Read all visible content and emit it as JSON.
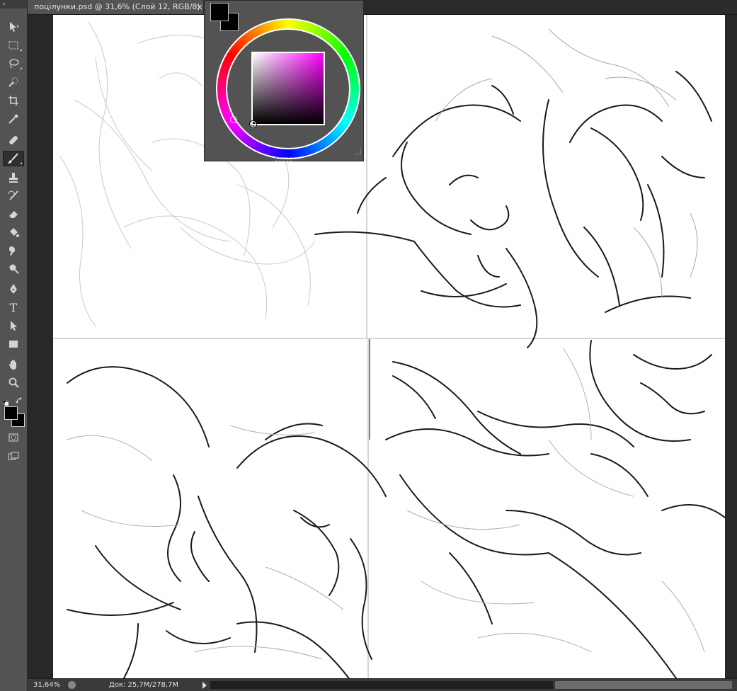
{
  "document_tab": {
    "title": "поцілунки.psd @ 31,6% (Слой 12, RGB/8)",
    "close_glyph": "×"
  },
  "toolbar": {
    "grip": "»",
    "tools": [
      {
        "name": "move",
        "icon": "move-icon"
      },
      {
        "name": "rectangular-marquee",
        "icon": "marquee-icon"
      },
      {
        "name": "lasso",
        "icon": "lasso-icon"
      },
      {
        "name": "quick-selection",
        "icon": "quick-selection-icon"
      },
      {
        "name": "crop",
        "icon": "crop-icon"
      },
      {
        "name": "eyedropper",
        "icon": "eyedropper-icon"
      },
      {
        "name": "spot-healing",
        "icon": "healing-icon"
      },
      {
        "name": "brush",
        "icon": "brush-icon",
        "active": true
      },
      {
        "name": "clone-stamp",
        "icon": "stamp-icon"
      },
      {
        "name": "history-brush",
        "icon": "history-brush-icon"
      },
      {
        "name": "eraser",
        "icon": "eraser-icon"
      },
      {
        "name": "paint-bucket",
        "icon": "bucket-icon"
      },
      {
        "name": "smudge",
        "icon": "smudge-icon"
      },
      {
        "name": "dodge",
        "icon": "dodge-icon"
      },
      {
        "name": "pen",
        "icon": "pen-icon"
      },
      {
        "name": "type",
        "icon": "type-icon",
        "label": "T"
      },
      {
        "name": "path-selection",
        "icon": "path-select-icon"
      },
      {
        "name": "rectangle",
        "icon": "rectangle-icon"
      },
      {
        "name": "hand",
        "icon": "hand-icon"
      },
      {
        "name": "zoom",
        "icon": "zoom-icon"
      }
    ],
    "foreground_color": "#000000",
    "background_color": "#000000"
  },
  "color_panel": {
    "foreground_color": "#000000",
    "background_color": "#000000",
    "hue_color": "#ff00ff"
  },
  "statusbar": {
    "zoom": "31,64%",
    "doc_info": "Док: 25,7M/278,7M"
  },
  "colors": {
    "ui_dark": "#282828",
    "ui_panel": "#535353",
    "canvas": "#ffffff"
  }
}
